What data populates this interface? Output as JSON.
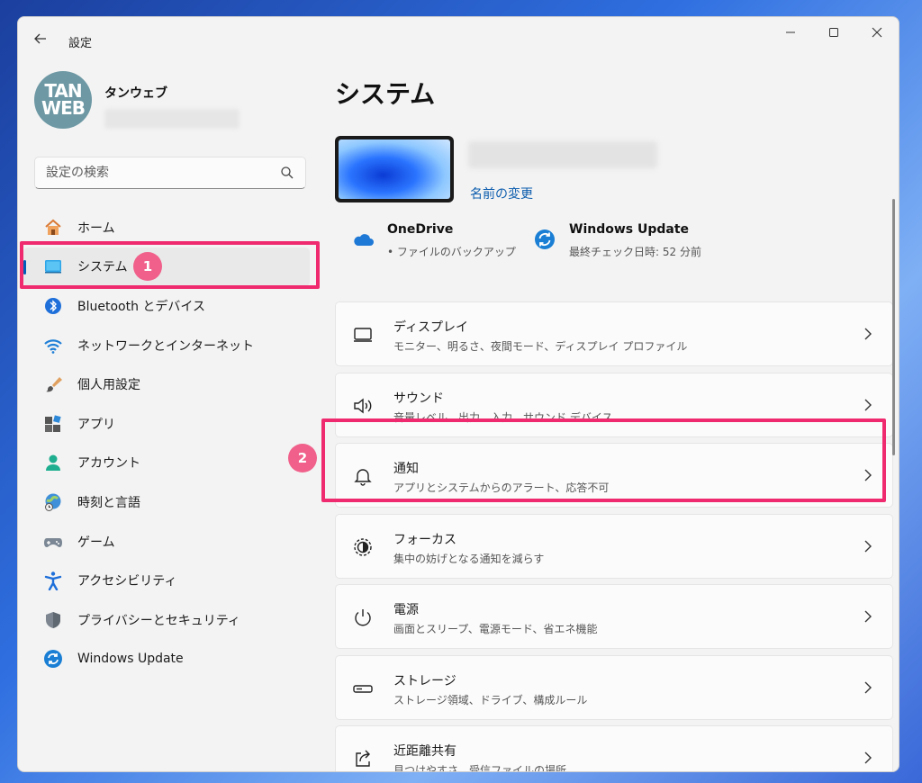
{
  "window": {
    "title": "設定"
  },
  "profile": {
    "avatar_line1": "TAN",
    "avatar_line2": "WEB",
    "name": "タンウェブ"
  },
  "search": {
    "placeholder": "設定の検索"
  },
  "sidebar": {
    "items": [
      {
        "label": "ホーム",
        "icon": "home-icon"
      },
      {
        "label": "システム",
        "icon": "system-icon"
      },
      {
        "label": "Bluetooth とデバイス",
        "icon": "bluetooth-icon"
      },
      {
        "label": "ネットワークとインターネット",
        "icon": "wifi-icon"
      },
      {
        "label": "個人用設定",
        "icon": "brush-icon"
      },
      {
        "label": "アプリ",
        "icon": "apps-icon"
      },
      {
        "label": "アカウント",
        "icon": "account-icon"
      },
      {
        "label": "時刻と言語",
        "icon": "time-language-icon"
      },
      {
        "label": "ゲーム",
        "icon": "gamepad-icon"
      },
      {
        "label": "アクセシビリティ",
        "icon": "accessibility-icon"
      },
      {
        "label": "プライバシーとセキュリティ",
        "icon": "shield-icon"
      },
      {
        "label": "Windows Update",
        "icon": "update-icon"
      }
    ]
  },
  "annotations": {
    "marker1": "1",
    "marker2": "2"
  },
  "main": {
    "title": "システム",
    "rename": "名前の変更",
    "onedrive": {
      "title": "OneDrive",
      "subtitle": "• ファイルのバックアップ"
    },
    "windows_update": {
      "title": "Windows Update",
      "subtitle": "最終チェック日時: 52 分前"
    },
    "settings": [
      {
        "title": "ディスプレイ",
        "subtitle": "モニター、明るさ、夜間モード、ディスプレイ プロファイル",
        "icon": "display-icon"
      },
      {
        "title": "サウンド",
        "subtitle": "音量レベル、出力、入力、サウンド デバイス",
        "icon": "speaker-icon"
      },
      {
        "title": "通知",
        "subtitle": "アプリとシステムからのアラート、応答不可",
        "icon": "bell-icon"
      },
      {
        "title": "フォーカス",
        "subtitle": "集中の妨げとなる通知を減らす",
        "icon": "focus-icon"
      },
      {
        "title": "電源",
        "subtitle": "画面とスリープ、電源モード、省エネ機能",
        "icon": "power-icon"
      },
      {
        "title": "ストレージ",
        "subtitle": "ストレージ領域、ドライブ、構成ルール",
        "icon": "storage-icon"
      },
      {
        "title": "近距離共有",
        "subtitle": "見つけやすさ、受信ファイルの場所",
        "icon": "share-icon"
      }
    ]
  },
  "colors": {
    "accent": "#005fb8",
    "highlight": "#f02a6e",
    "marker": "#f0608a"
  }
}
